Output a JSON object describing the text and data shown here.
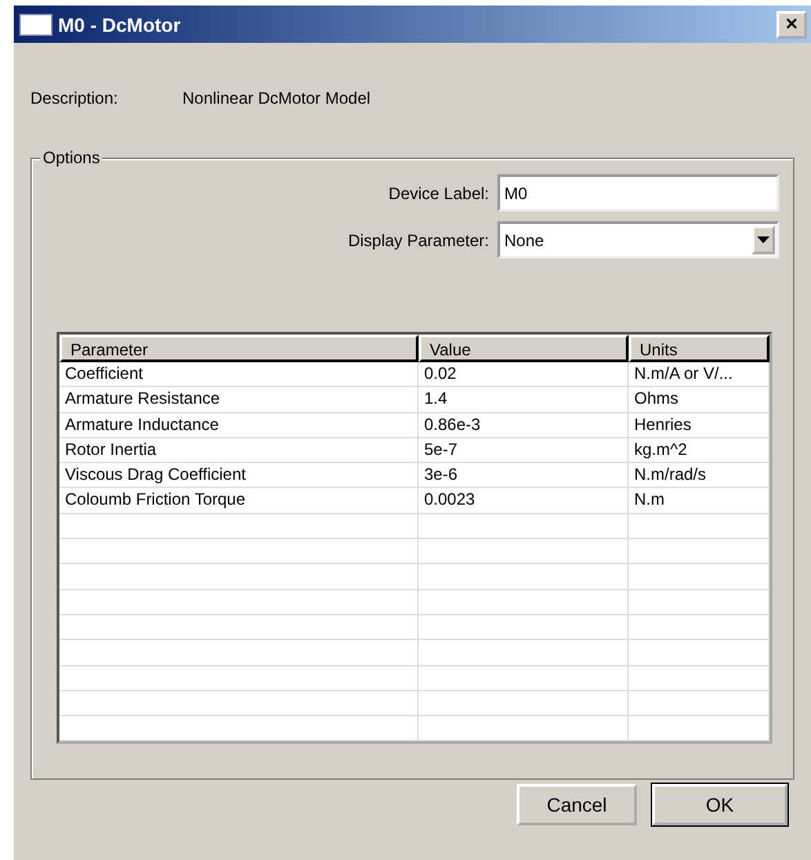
{
  "window": {
    "title": "M0 - DcMotor",
    "close": "×"
  },
  "description": {
    "label": "Description:",
    "value": "Nonlinear DcMotor Model"
  },
  "options": {
    "title": "Options",
    "device_label": {
      "label": "Device Label:",
      "value": "M0"
    },
    "display_parameter": {
      "label": "Display Parameter:",
      "value": "None"
    }
  },
  "table": {
    "columns": [
      "Parameter",
      "Value",
      "Units"
    ],
    "rows": [
      [
        "Coefficient",
        "0.02",
        "N.m/A or V/..."
      ],
      [
        "Armature Resistance",
        "1.4",
        "Ohms"
      ],
      [
        "Armature Inductance",
        "0.86e-3",
        "Henries"
      ],
      [
        "Rotor Inertia",
        "5e-7",
        "kg.m^2"
      ],
      [
        "Viscous Drag Coefficient",
        "3e-6",
        "N.m/rad/s"
      ],
      [
        "Coloumb Friction Torque",
        "0.0023",
        "N.m"
      ]
    ]
  },
  "buttons": [
    {
      "label": "Cancel",
      "default": false
    },
    {
      "label": "OK",
      "default": true
    }
  ]
}
